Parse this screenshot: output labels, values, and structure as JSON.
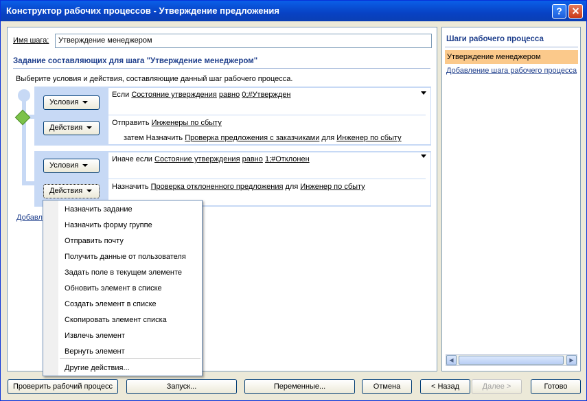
{
  "window": {
    "title": "Конструктор рабочих процессов - Утверждение предложения",
    "help": "?",
    "close": "✕"
  },
  "step": {
    "name_label": "Имя шага:",
    "name_value": "Утверждение менеджером",
    "section_title": "Задание составляющих для шага \"Утверждение менеджером\"",
    "description": "Выберите условия и действия, составляющие данный шаг рабочего процесса."
  },
  "branch1": {
    "conditions_btn": "Условия",
    "actions_btn": "Действия",
    "cond": {
      "prefix": "Если",
      "field": "Состояние утверждения",
      "op": "равно",
      "value": "0;#Утвержден"
    },
    "action1": {
      "verb": "Отправить",
      "target": "Инженеры по сбыту"
    },
    "action2": {
      "prefix": "затем Назначить",
      "task": "Проверка предложения с заказчиками",
      "for": "для",
      "who": "Инженер по сбыту"
    }
  },
  "branch2": {
    "conditions_btn": "Условия",
    "actions_btn": "Действия",
    "cond": {
      "prefix": "Иначе если",
      "field": "Состояние утверждения",
      "op": "равно",
      "value": "1;#Отклонен"
    },
    "action1": {
      "verb": "Назначить",
      "task": "Проверка отклоненного предложения",
      "for": "для",
      "who": "Инженер по сбыту"
    }
  },
  "add_branch_partial": "Добавл",
  "menu": {
    "items": [
      "Назначить задание",
      "Назначить форму группе",
      "Отправить почту",
      "Получить данные от пользователя",
      "Задать поле в текущем элементе",
      "Обновить элемент в списке",
      "Создать элемент в списке",
      "Скопировать элемент списка",
      "Извлечь элемент",
      "Вернуть элемент"
    ],
    "more": "Другие действия..."
  },
  "steps_panel": {
    "title": "Шаги рабочего процесса",
    "selected": "Утверждение менеджером",
    "add_link": "Добавление шага рабочего процесса"
  },
  "footer": {
    "check": "Проверить рабочий процесс",
    "start": "Запуск...",
    "variables": "Переменные...",
    "cancel": "Отмена",
    "back": "< Назад",
    "next": "Далее >",
    "finish": "Готово"
  },
  "colors": {
    "accent": "#1f3f8c",
    "branch_bg": "#c7d9f5",
    "selection": "#fbc98b",
    "diamond": "#7cc24a"
  }
}
